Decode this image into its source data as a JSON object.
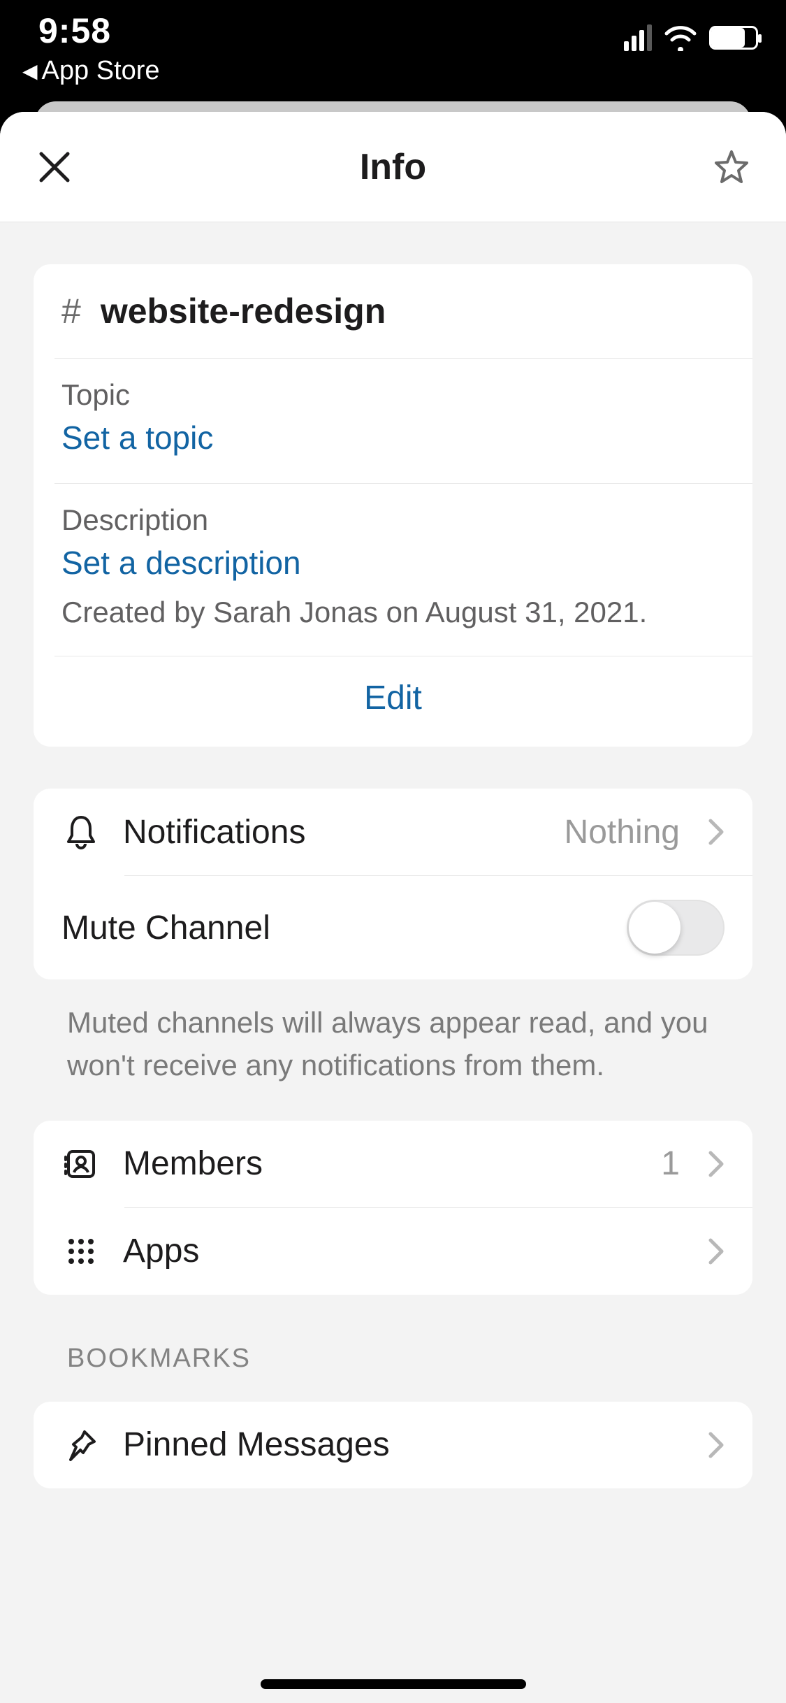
{
  "status": {
    "time": "9:58",
    "back_app_prefix": "◀",
    "back_app": "App Store"
  },
  "nav": {
    "title": "Info"
  },
  "channel": {
    "hash": "#",
    "name": "website-redesign",
    "topic_label": "Topic",
    "topic_placeholder": "Set a topic",
    "description_label": "Description",
    "description_placeholder": "Set a description",
    "created_by": "Created by Sarah Jonas on August 31, 2021.",
    "edit_label": "Edit"
  },
  "notifications": {
    "label": "Notifications",
    "value": "Nothing"
  },
  "mute": {
    "label": "Mute Channel",
    "help": "Muted channels will always appear read, and you won't receive any notifications from them."
  },
  "members": {
    "label": "Members",
    "count": "1"
  },
  "apps": {
    "label": "Apps"
  },
  "bookmarks": {
    "title": "BOOKMARKS",
    "pinned_label": "Pinned Messages"
  }
}
